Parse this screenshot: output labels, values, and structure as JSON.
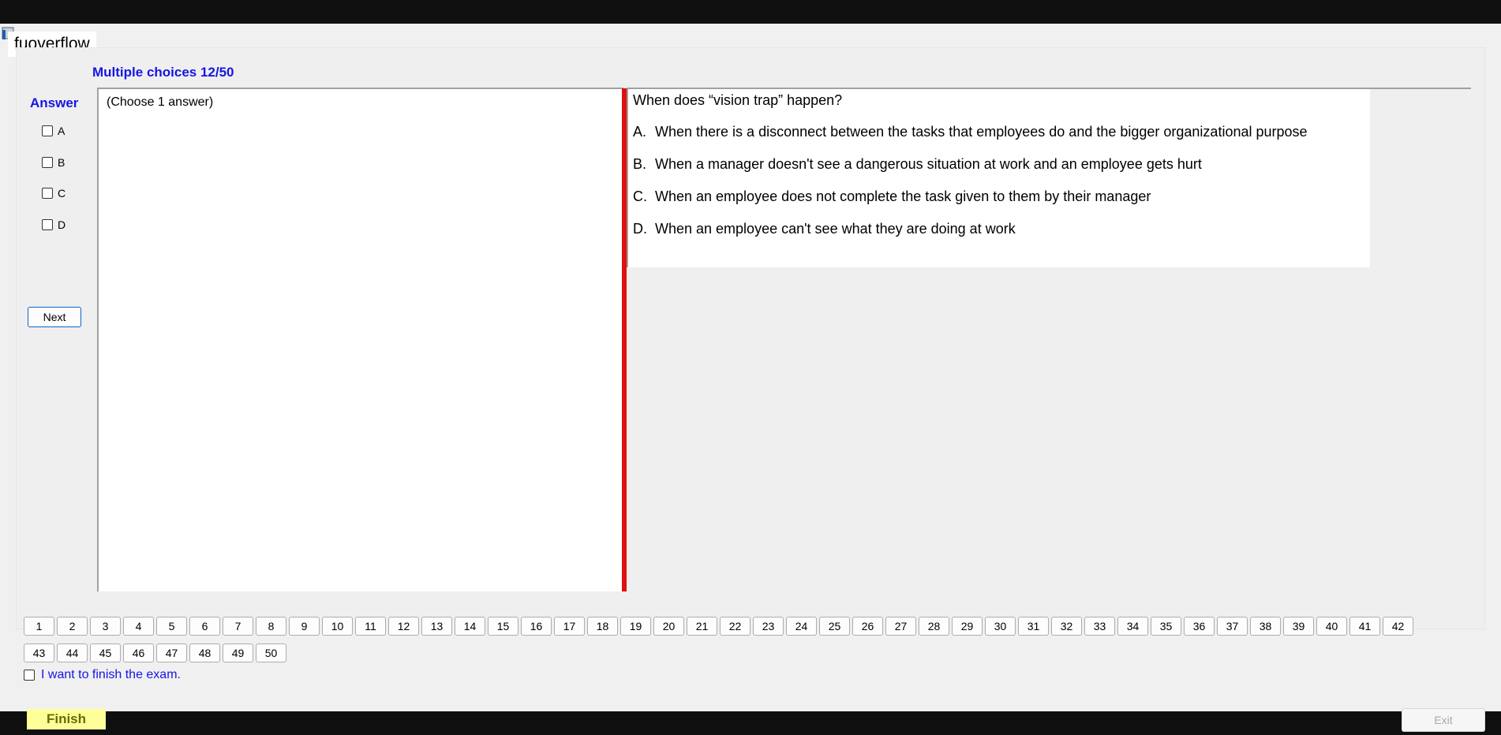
{
  "app": {
    "title": "fuoverflow"
  },
  "exam": {
    "section_title": "Multiple choices 12/50",
    "answer_label": "Answer",
    "options": [
      "A",
      "B",
      "C",
      "D"
    ],
    "next_label": "Next",
    "instruction": "(Choose 1 answer)"
  },
  "question": {
    "text": "When does “vision trap” happen?",
    "choices": [
      {
        "letter": "A.",
        "text": "When there is a disconnect between the tasks that employees do and the bigger organizational purpose"
      },
      {
        "letter": "B.",
        "text": "When a manager doesn't see a dangerous situation at work and an employee gets hurt"
      },
      {
        "letter": "C.",
        "text": "When an employee does not complete the task given to them by their manager"
      },
      {
        "letter": "D.",
        "text": "When an employee can't see what they are doing at work"
      }
    ]
  },
  "navigation": {
    "row1": [
      "1",
      "2",
      "3",
      "4",
      "5",
      "6",
      "7",
      "8",
      "9",
      "10",
      "11",
      "12",
      "13",
      "14",
      "15",
      "16",
      "17",
      "18",
      "19",
      "20",
      "21",
      "22",
      "23",
      "24",
      "25",
      "26",
      "27",
      "28",
      "29",
      "30",
      "31",
      "32",
      "33",
      "34",
      "35",
      "36",
      "37",
      "38",
      "39",
      "40",
      "41",
      "42"
    ],
    "row2": [
      "43",
      "44",
      "45",
      "46",
      "47",
      "48",
      "49",
      "50"
    ]
  },
  "footer": {
    "finish_checkbox_label": "I want to finish the exam.",
    "finish_label": "Finish",
    "exit_label": "Exit"
  },
  "colors": {
    "accent_blue": "#1515e6",
    "divider_red": "#e01010",
    "finish_yellow": "#ffff99"
  }
}
